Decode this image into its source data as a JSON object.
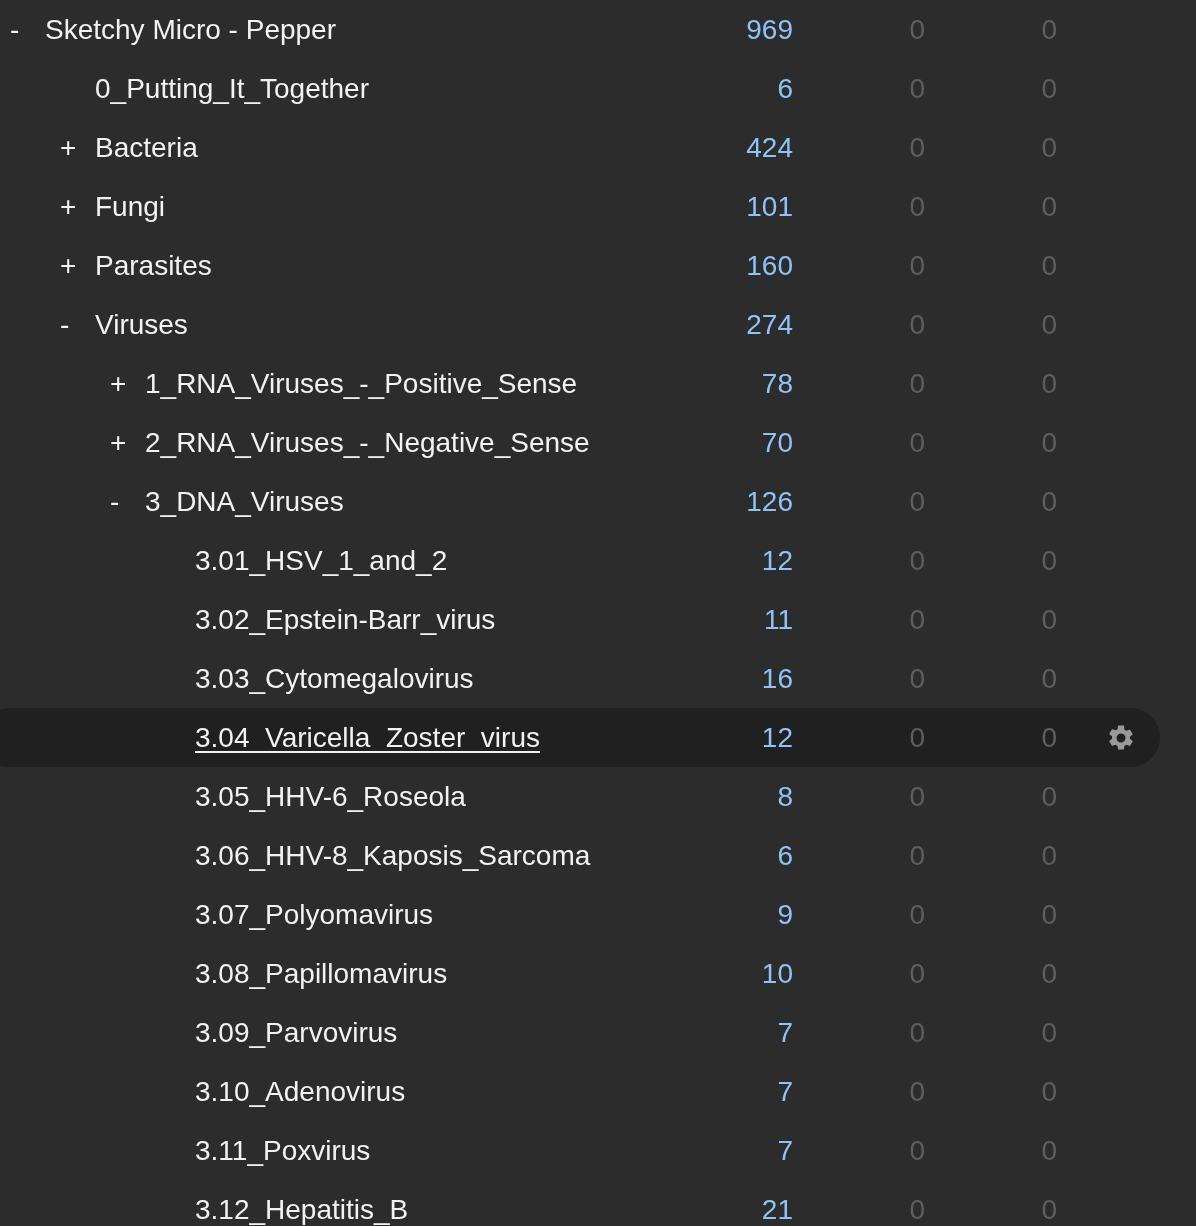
{
  "decks": [
    {
      "name": "Sketchy Micro - Pepper",
      "toggle": "-",
      "new": "969",
      "learn": "0",
      "due": "0",
      "selected": false,
      "children": [
        {
          "name": "0_Putting_It_Together",
          "new": "6",
          "learn": "0",
          "due": "0",
          "selected": false
        },
        {
          "name": "Bacteria",
          "toggle": "+",
          "new": "424",
          "learn": "0",
          "due": "0",
          "selected": false
        },
        {
          "name": "Fungi",
          "toggle": "+",
          "new": "101",
          "learn": "0",
          "due": "0",
          "selected": false
        },
        {
          "name": "Parasites",
          "toggle": "+",
          "new": "160",
          "learn": "0",
          "due": "0",
          "selected": false
        },
        {
          "name": "Viruses",
          "toggle": "-",
          "new": "274",
          "learn": "0",
          "due": "0",
          "selected": false,
          "children": [
            {
              "name": "1_RNA_Viruses_-_Positive_Sense",
              "toggle": "+",
              "new": "78",
              "learn": "0",
              "due": "0",
              "selected": false
            },
            {
              "name": "2_RNA_Viruses_-_Negative_Sense",
              "toggle": "+",
              "new": "70",
              "learn": "0",
              "due": "0",
              "selected": false
            },
            {
              "name": "3_DNA_Viruses",
              "toggle": "-",
              "new": "126",
              "learn": "0",
              "due": "0",
              "selected": false,
              "children": [
                {
                  "name": "3.01_HSV_1_and_2",
                  "new": "12",
                  "learn": "0",
                  "due": "0",
                  "selected": false
                },
                {
                  "name": "3.02_Epstein-Barr_virus",
                  "new": "11",
                  "learn": "0",
                  "due": "0",
                  "selected": false
                },
                {
                  "name": "3.03_Cytomegalovirus",
                  "new": "16",
                  "learn": "0",
                  "due": "0",
                  "selected": false
                },
                {
                  "name": "3.04_Varicella_Zoster_virus",
                  "new": "12",
                  "learn": "0",
                  "due": "0",
                  "selected": true
                },
                {
                  "name": "3.05_HHV-6_Roseola",
                  "new": "8",
                  "learn": "0",
                  "due": "0",
                  "selected": false
                },
                {
                  "name": "3.06_HHV-8_Kaposis_Sarcoma",
                  "new": "6",
                  "learn": "0",
                  "due": "0",
                  "selected": false
                },
                {
                  "name": "3.07_Polyomavirus",
                  "new": "9",
                  "learn": "0",
                  "due": "0",
                  "selected": false
                },
                {
                  "name": "3.08_Papillomavirus",
                  "new": "10",
                  "learn": "0",
                  "due": "0",
                  "selected": false
                },
                {
                  "name": "3.09_Parvovirus",
                  "new": "7",
                  "learn": "0",
                  "due": "0",
                  "selected": false
                },
                {
                  "name": "3.10_Adenovirus",
                  "new": "7",
                  "learn": "0",
                  "due": "0",
                  "selected": false
                },
                {
                  "name": "3.11_Poxvirus",
                  "new": "7",
                  "learn": "0",
                  "due": "0",
                  "selected": false
                },
                {
                  "name": "3.12_Hepatitis_B",
                  "new": "21",
                  "learn": "0",
                  "due": "0",
                  "selected": false
                }
              ]
            }
          ]
        }
      ]
    }
  ]
}
